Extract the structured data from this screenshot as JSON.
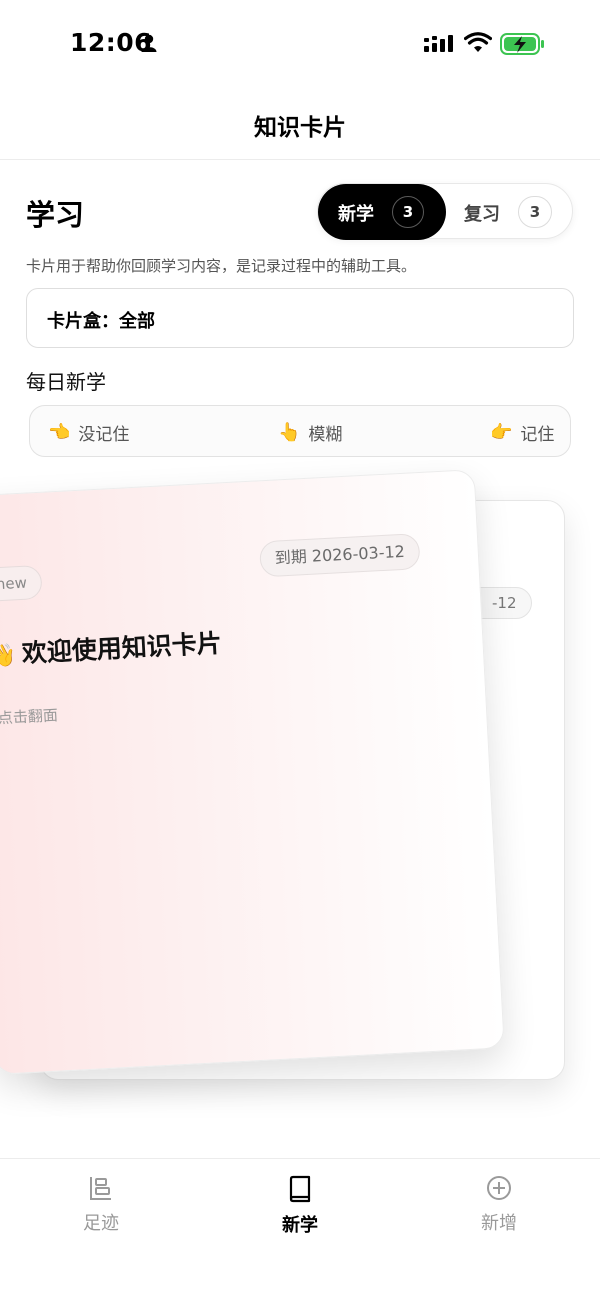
{
  "status_bar": {
    "time": "12:06"
  },
  "header": {
    "title": "知识卡片"
  },
  "section": {
    "title": "学习",
    "description": "卡片用于帮助你回顾学习内容，是记录过程中的辅助工具。",
    "tabs": [
      {
        "label": "新学",
        "count": "3"
      },
      {
        "label": "复习",
        "count": "3"
      }
    ]
  },
  "deck": {
    "label": "卡片盒：全部"
  },
  "daily": {
    "title": "每日新学"
  },
  "actions": [
    {
      "emoji": "👈",
      "label": "没记住"
    },
    {
      "emoji": "👆",
      "label": "模糊"
    },
    {
      "emoji": "👉",
      "label": "记住"
    }
  ],
  "card_front": {
    "badge": "new",
    "due": "到期 2026-03-12",
    "emoji": "👋",
    "title": "欢迎使用知识卡片",
    "hint": "点击翻面"
  },
  "card_back": {
    "due": "-12"
  },
  "tab_bar": [
    {
      "label": "足迹",
      "icon": "footprint-icon"
    },
    {
      "label": "新学",
      "icon": "book-icon"
    },
    {
      "label": "新增",
      "icon": "plus-circle-icon"
    }
  ],
  "colors": {
    "accent": "#000000",
    "card_tint": "#fde6e6",
    "muted": "#999999"
  }
}
